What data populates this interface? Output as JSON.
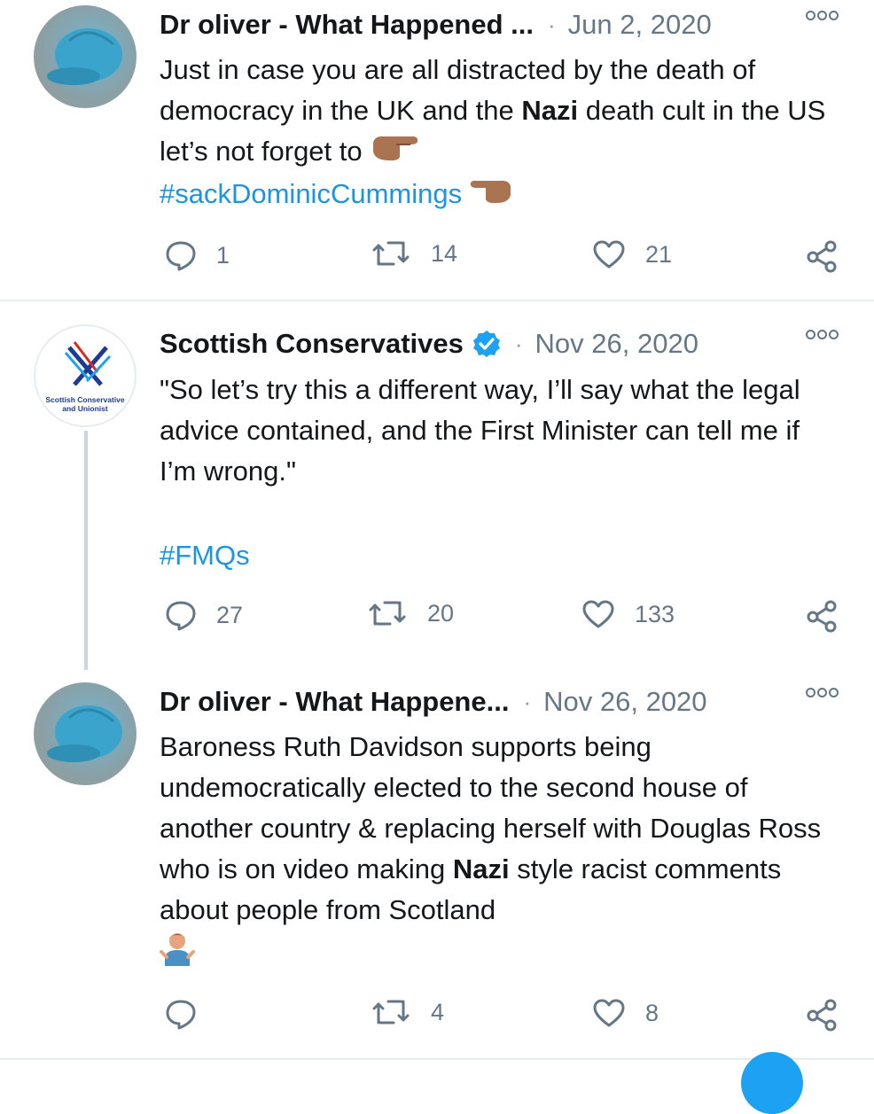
{
  "tweets": [
    {
      "author": "Dr oliver - What Happened ...",
      "date": "Jun 2, 2020",
      "dot": "·",
      "body": [
        {
          "t": "Just in case you are all distracted by the death of democracy in the UK and the "
        },
        {
          "t": "Nazi",
          "b": true
        },
        {
          "t": " death cult in the US let’s not forget to "
        }
      ],
      "hashtag": "#sackDominicCummings",
      "replies": "1",
      "retweets": "14",
      "likes": "21"
    },
    {
      "author": "Scottish Conservatives",
      "verified": true,
      "logo_text": "Scottish Conservative and Unionist",
      "date": "Nov 26, 2020",
      "dot": "·",
      "body_text": "\"So let’s try this a different way, I’ll say what the legal advice contained, and the First Minister can tell me if I’m wrong.\"",
      "hashtag": "#FMQs",
      "replies": "27",
      "retweets": "20",
      "likes": "133"
    },
    {
      "author": "Dr oliver - What Happene...",
      "date": "Nov 26, 2020",
      "dot": "·",
      "body": [
        {
          "t": "Baroness Ruth Davidson supports being undemocratically elected to the second house of another country & replacing herself with Douglas Ross who is on video making "
        },
        {
          "t": "Nazi",
          "b": true
        },
        {
          "t": " style racist comments about people from Scotland"
        }
      ],
      "replies": "",
      "retweets": "4",
      "likes": "8"
    }
  ],
  "colors": {
    "link": "#1b95e0",
    "muted": "#657786",
    "divider": "#e6ecf0",
    "verified": "#1da1f2"
  },
  "icons": [
    "reply-icon",
    "retweet-icon",
    "like-icon",
    "share-icon",
    "more-icon",
    "verified-badge-icon",
    "pointing-hand-emoji",
    "shrug-emoji"
  ]
}
